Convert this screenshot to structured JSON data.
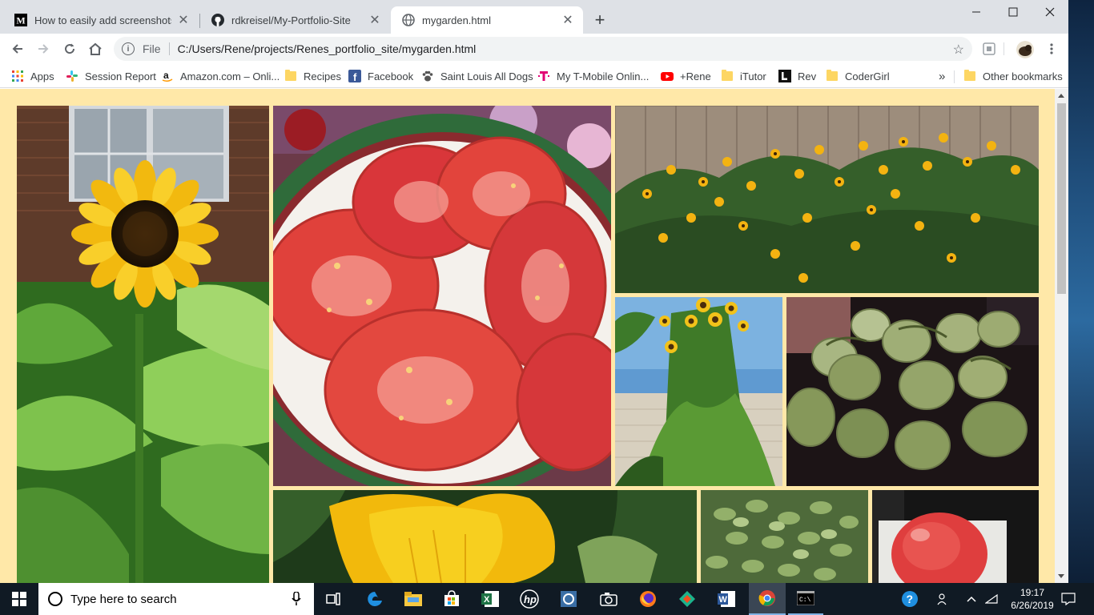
{
  "browser": {
    "tabs": [
      {
        "title": "How to easily add screenshots in",
        "icon": "medium-icon",
        "active": false
      },
      {
        "title": "rdkreisel/My-Portfolio-Site",
        "icon": "github-icon",
        "active": false
      },
      {
        "title": "mygarden.html",
        "icon": "globe-icon",
        "active": true
      }
    ],
    "new_tab": "+",
    "window_controls": {
      "minimize": "—",
      "maximize": "☐",
      "close": "✕"
    },
    "address": {
      "scheme": "File",
      "url": "C:/Users/Rene/projects/Renes_portfolio_site/mygarden.html"
    },
    "bookmarks": [
      {
        "label": "Apps",
        "icon": "apps-grid-icon"
      },
      {
        "label": "Session Report",
        "icon": "slack-icon"
      },
      {
        "label": "Amazon.com – Onli...",
        "icon": "amazon-icon"
      },
      {
        "label": "Recipes",
        "icon": "folder-icon"
      },
      {
        "label": "Facebook",
        "icon": "facebook-icon"
      },
      {
        "label": "Saint Louis All Dogs",
        "icon": "paw-icon"
      },
      {
        "label": "My T-Mobile Onlin...",
        "icon": "tmobile-icon"
      },
      {
        "label": "+Rene",
        "icon": "youtube-icon"
      },
      {
        "label": "iTutor",
        "icon": "folder-icon"
      },
      {
        "label": "Rev",
        "icon": "rev-icon"
      },
      {
        "label": "CoderGirl",
        "icon": "folder-icon"
      }
    ],
    "bookmarks_overflow": "»",
    "other_bookmarks": "Other bookmarks"
  },
  "page": {
    "background": "#ffe8a8",
    "photos": [
      {
        "name": "sunflower-photo"
      },
      {
        "name": "tomato-slices-photo"
      },
      {
        "name": "black-eyed-susans-photo"
      },
      {
        "name": "tall-sunflowers-photo"
      },
      {
        "name": "green-tomatoes-photo"
      },
      {
        "name": "squash-blossom-photo"
      },
      {
        "name": "sage-plant-photo"
      },
      {
        "name": "pink-tomato-photo"
      }
    ]
  },
  "taskbar": {
    "search_placeholder": "Type here to search",
    "time": "19:17",
    "date": "6/26/2019",
    "apps": [
      "task-view-icon",
      "edge-icon",
      "file-explorer-icon",
      "store-icon",
      "excel-icon",
      "hp-icon",
      "app-icon",
      "camera-icon",
      "firefox-icon",
      "gitkraken-icon",
      "word-icon",
      "chrome-icon",
      "terminal-icon"
    ]
  }
}
